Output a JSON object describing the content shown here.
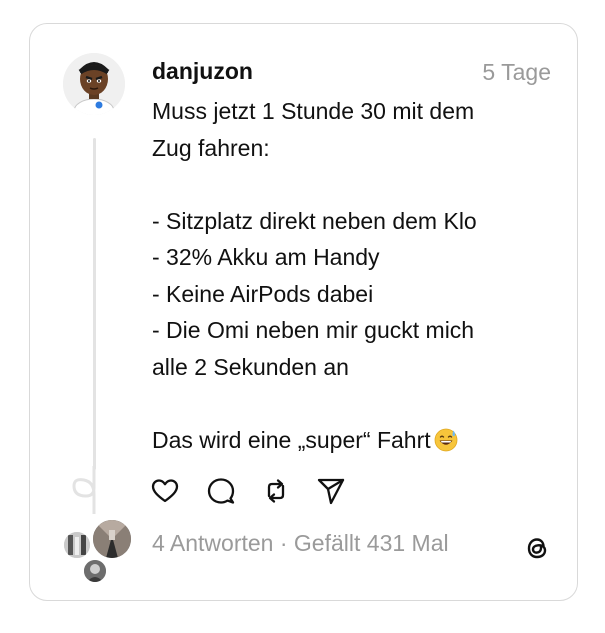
{
  "post": {
    "username": "danjuzon",
    "timestamp": "5 Tage",
    "body_lines": [
      "Muss jetzt 1 Stunde 30 mit dem",
      "Zug fahren:",
      "",
      "- Sitzplatz direkt neben dem Klo",
      "- 32% Akku am Handy",
      "- Keine AirPods dabei",
      "- Die Omi neben mir guckt mich",
      "alle 2 Sekunden an",
      "",
      "Das wird eine „super“ Fahrt"
    ],
    "emoji": "grinning-face-with-sweat"
  },
  "actions": [
    "like-icon",
    "comment-icon",
    "repost-icon",
    "share-icon"
  ],
  "footer": {
    "replies_text": "4 Antworten · Gefällt 431 Mal"
  },
  "colors": {
    "text": "#111111",
    "muted": "#9a9a9a",
    "border": "#d9d9d9",
    "thread_line": "#e3e3e3"
  }
}
